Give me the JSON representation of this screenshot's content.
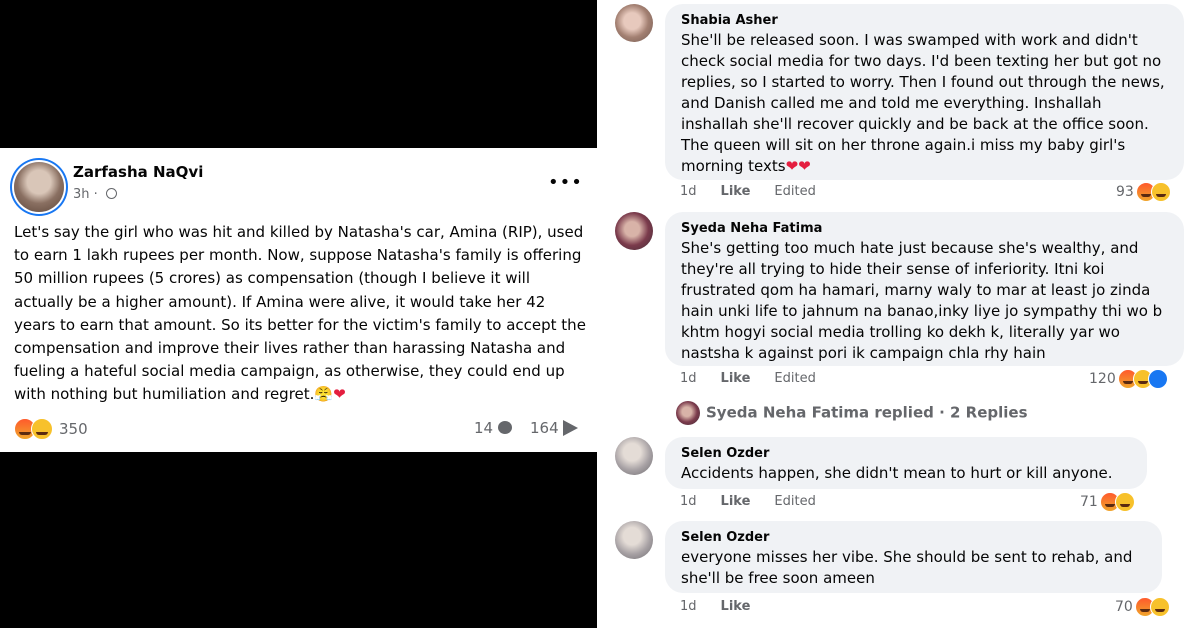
{
  "post": {
    "author": "Zarfasha NaQvi",
    "time": "3h",
    "menu": "•••",
    "body": "Let's say the girl who was hit and killed by Natasha's car, Amina (RIP), used to earn 1 lakh rupees per month. Now, suppose Natasha's family is offering 50 million rupees (5 crores) as compensation (though I believe it will actually be a higher amount). If Amina were alive, it would take her 42 years to earn that amount. So its better for the victim's family to accept the compensation and improve their lives rather than harassing Natasha and fueling a hateful social media campaign, as otherwise, they could end up with nothing but humiliation and regret.",
    "body_emoji": "😤",
    "body_heart": "❤",
    "reactions_count": "350",
    "comments_count": "14",
    "shares_count": "164"
  },
  "comments": [
    {
      "name": "Shabia Asher",
      "text": "She'll be released soon. I was swamped with work and didn't check social media for two days. I'd been texting her but got no replies, so I started to worry. Then I found out through the news, and Danish called me and told me everything. Inshallah inshallah she'll recover quickly and be back at the office soon. The queen will sit on her throne again.i miss my baby girl's morning texts",
      "hearts": "❤❤",
      "time": "1d",
      "like": "Like",
      "edited": "Edited",
      "reactions": "93"
    },
    {
      "name": "Syeda Neha Fatima",
      "text": "She's getting too much hate just because she's wealthy, and they're all trying to hide their sense of inferiority. Itni koi frustrated qom ha hamari, marny waly to mar at least jo zinda hain unki life to jahnum na banao,inky liye jo sympathy thi wo b khtm hogyi social media trolling ko dekh k, literally yar wo nastsha k against pori ik campaign chla rhy hain",
      "time": "1d",
      "like": "Like",
      "edited": "Edited",
      "reactions": "120"
    },
    {
      "name": "Selen Ozder",
      "text": "Accidents happen, she didn't mean to hurt or kill anyone.",
      "time": "1d",
      "like": "Like",
      "edited": "Edited",
      "reactions": "71"
    },
    {
      "name": "Selen Ozder",
      "text": "everyone misses her vibe. She should be sent to rehab, and she'll be free soon ameen",
      "time": "1d",
      "like": "Like",
      "reactions": "70"
    }
  ],
  "replies_line": "Syeda Neha Fatima replied · 2 Replies",
  "icons": {
    "angry": "angry-reaction-icon",
    "haha": "haha-reaction-icon",
    "like": "like-reaction-icon",
    "globe": "globe-icon",
    "comment": "comment-icon",
    "share": "share-icon"
  },
  "colors": {
    "accent": "#1877f2",
    "bubble": "#f0f2f5",
    "muted": "#65676b",
    "heart": "#e41e3f"
  }
}
